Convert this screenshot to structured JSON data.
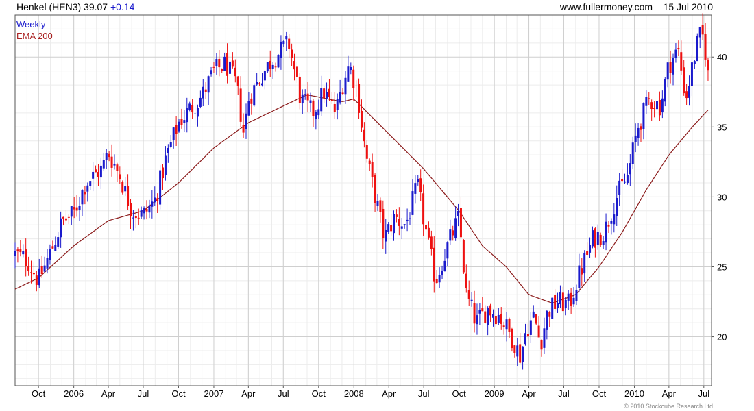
{
  "header": {
    "ticker": "Henkel (HEN3)",
    "price": "39.07",
    "change": "+0.14",
    "site": "www.fullermoney.com",
    "date": "15 Jul 2010"
  },
  "legend": {
    "period": "Weekly",
    "ema": "EMA 200"
  },
  "copyright": "© 2010 Stockcube Research Ltd",
  "colors": {
    "up": "#1a1acc",
    "down": "#ee1111",
    "ema": "#8b1a1a",
    "grid": "#cfcfcf",
    "border": "#555555"
  },
  "chart_data": {
    "type": "candlestick",
    "frequency": "weekly",
    "y_ticks": [
      20,
      25,
      30,
      35,
      40
    ],
    "y_range": [
      16.5,
      43.0
    ],
    "x_labels": [
      "Oct",
      "2006",
      "Apr",
      "Jul",
      "Oct",
      "2007",
      "Apr",
      "Jul",
      "Oct",
      "2008",
      "Apr",
      "Jul",
      "Oct",
      "2009",
      "Apr",
      "Jul",
      "Oct",
      "2010",
      "Apr",
      "Jul"
    ],
    "price_anchors": [
      [
        "2005-08-01",
        25.9
      ],
      [
        "2005-09-01",
        25.5
      ],
      [
        "2005-10-01",
        24.0
      ],
      [
        "2005-11-01",
        26.0
      ],
      [
        "2005-12-01",
        28.2
      ],
      [
        "2006-01-01",
        28.8
      ],
      [
        "2006-02-01",
        31.0
      ],
      [
        "2006-03-15",
        32.0
      ],
      [
        "2006-04-01",
        33.2
      ],
      [
        "2006-05-01",
        31.5
      ],
      [
        "2006-06-01",
        29.0
      ],
      [
        "2006-07-01",
        28.7
      ],
      [
        "2006-08-01",
        29.8
      ],
      [
        "2006-09-01",
        33.0
      ],
      [
        "2006-10-01",
        35.3
      ],
      [
        "2006-11-01",
        36.3
      ],
      [
        "2006-12-01",
        37.2
      ],
      [
        "2007-01-01",
        39.0
      ],
      [
        "2007-02-01",
        39.5
      ],
      [
        "2007-03-01",
        38.0
      ],
      [
        "2007-03-20",
        34.5
      ],
      [
        "2007-04-01",
        37.0
      ],
      [
        "2007-05-01",
        38.5
      ],
      [
        "2007-06-01",
        39.8
      ],
      [
        "2007-07-15",
        41.0
      ],
      [
        "2007-08-15",
        37.0
      ],
      [
        "2007-09-15",
        36.0
      ],
      [
        "2007-10-15",
        37.5
      ],
      [
        "2007-11-15",
        36.0
      ],
      [
        "2007-12-01",
        38.0
      ],
      [
        "2007-12-20",
        39.5
      ],
      [
        "2008-01-10",
        37.5
      ],
      [
        "2008-02-01",
        33.0
      ],
      [
        "2008-03-01",
        29.5
      ],
      [
        "2008-03-20",
        27.0
      ],
      [
        "2008-04-15",
        28.5
      ],
      [
        "2008-05-15",
        28.0
      ],
      [
        "2008-06-15",
        30.8
      ],
      [
        "2008-07-10",
        27.0
      ],
      [
        "2008-08-01",
        24.0
      ],
      [
        "2008-08-20",
        25.5
      ],
      [
        "2008-09-15",
        27.5
      ],
      [
        "2008-10-01",
        28.5
      ],
      [
        "2008-10-20",
        23.0
      ],
      [
        "2008-11-15",
        21.0
      ],
      [
        "2008-12-15",
        22.0
      ],
      [
        "2009-01-15",
        21.5
      ],
      [
        "2009-02-15",
        20.0
      ],
      [
        "2009-03-10",
        18.6
      ],
      [
        "2009-03-25",
        20.5
      ],
      [
        "2009-04-15",
        21.5
      ],
      [
        "2009-05-01",
        19.5
      ],
      [
        "2009-05-20",
        21.8
      ],
      [
        "2009-06-15",
        22.5
      ],
      [
        "2009-07-15",
        22.3
      ],
      [
        "2009-08-15",
        24.8
      ],
      [
        "2009-09-15",
        27.0
      ],
      [
        "2009-10-15",
        27.5
      ],
      [
        "2009-11-15",
        30.0
      ],
      [
        "2009-12-15",
        31.5
      ],
      [
        "2010-01-10",
        35.0
      ],
      [
        "2010-02-10",
        37.0
      ],
      [
        "2010-03-10",
        36.5
      ],
      [
        "2010-04-01",
        39.5
      ],
      [
        "2010-04-25",
        40.5
      ],
      [
        "2010-05-15",
        37.0
      ],
      [
        "2010-06-10",
        40.5
      ],
      [
        "2010-06-25",
        41.8
      ],
      [
        "2010-07-15",
        39.07
      ]
    ],
    "ema_anchors": [
      [
        "2005-08-01",
        23.4
      ],
      [
        "2005-10-01",
        24.2
      ],
      [
        "2006-01-01",
        26.5
      ],
      [
        "2006-04-01",
        28.3
      ],
      [
        "2006-07-01",
        29.0
      ],
      [
        "2006-10-01",
        31.0
      ],
      [
        "2007-01-01",
        33.5
      ],
      [
        "2007-04-01",
        35.3
      ],
      [
        "2007-07-01",
        36.5
      ],
      [
        "2007-09-01",
        37.3
      ],
      [
        "2007-12-01",
        36.8
      ],
      [
        "2008-01-01",
        37.0
      ],
      [
        "2008-04-01",
        34.5
      ],
      [
        "2008-07-01",
        32.0
      ],
      [
        "2008-10-01",
        29.0
      ],
      [
        "2008-12-01",
        26.5
      ],
      [
        "2009-02-01",
        25.0
      ],
      [
        "2009-04-01",
        23.0
      ],
      [
        "2009-06-01",
        22.4
      ],
      [
        "2009-08-01",
        23.0
      ],
      [
        "2009-10-01",
        25.0
      ],
      [
        "2009-12-01",
        27.5
      ],
      [
        "2010-02-01",
        30.5
      ],
      [
        "2010-04-01",
        33.0
      ],
      [
        "2010-06-01",
        35.0
      ],
      [
        "2010-07-15",
        36.3
      ]
    ]
  }
}
